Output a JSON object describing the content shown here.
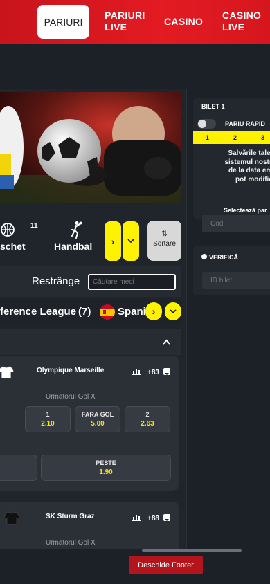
{
  "nav": {
    "active": "PARIURI",
    "pariuri_live_1": "PARIURI",
    "pariuri_live_2": "LIVE",
    "casino": "CASINO",
    "casino_live_1": "CASINO",
    "casino_live_2": "LIVE"
  },
  "sports": {
    "basket_label": "schet",
    "basket_count": "11",
    "handbal_label": "Handbal",
    "sort_label": "Sortare"
  },
  "search": {
    "collapse_label": "Restrânge",
    "placeholder": "Căutare meci"
  },
  "league": {
    "title": "ference League",
    "count": "(7)",
    "country": "Spani"
  },
  "matches": [
    {
      "team": "Olympique Marseille",
      "more_markets": "+83",
      "market": "Urmatorul Gol X",
      "odds": [
        {
          "label": "1",
          "value": "2.10"
        },
        {
          "label": "FARA GOL",
          "value": "5.00"
        },
        {
          "label": "2",
          "value": "2.63"
        }
      ],
      "over": {
        "label": "PESTE",
        "value": "1.90"
      }
    },
    {
      "team": "SK Sturm Graz",
      "more_markets": "+88",
      "market": "Urmatorul Gol X"
    }
  ],
  "bilet": {
    "title": "BILET 1",
    "rapid_label": "PARIU RAPID",
    "tabs": [
      "1",
      "2",
      "3"
    ],
    "info_lines": [
      "Salvările tale vo",
      "sistemul nostru t",
      "de la data emite",
      "pot modifica l"
    ],
    "select_label": "Selectează par",
    "code_placeholder": "Cod"
  },
  "verifica": {
    "label": "VERIFICĂ",
    "id_placeholder": "ID bilet"
  },
  "footer": {
    "button_label": "Deschide Footer"
  },
  "colors": {
    "brand_red": "#e31b23",
    "accent_yellow": "#fff200",
    "odds_yellow": "#f7e600",
    "background": "#1c2027"
  }
}
